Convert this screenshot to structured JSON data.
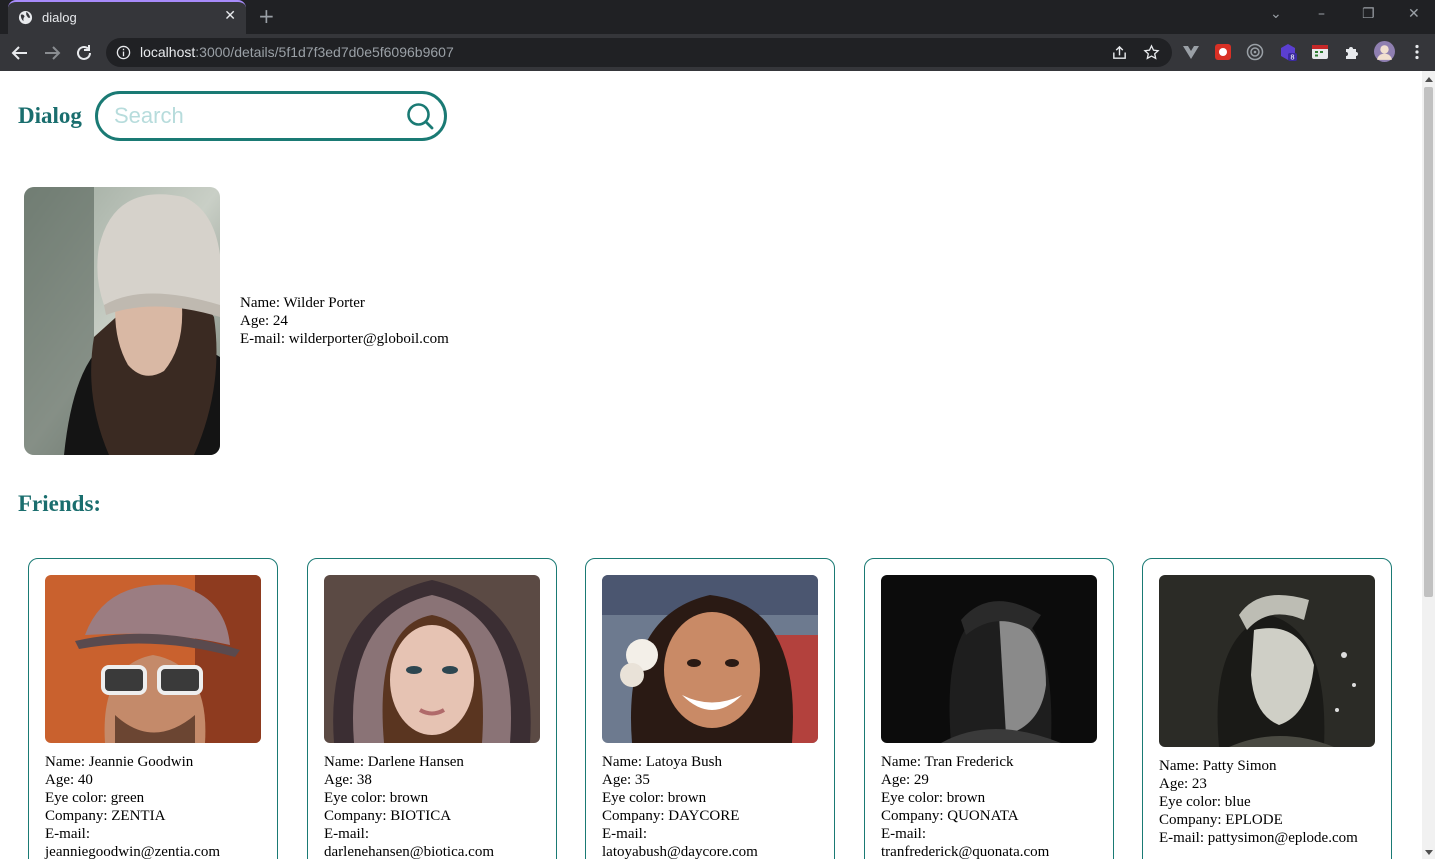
{
  "browser": {
    "tab_title": "dialog",
    "url_host": "localhost",
    "url_rest": ":3000/details/5f1d7f3ed7d0e5f6096b9607",
    "extension_badge": "8"
  },
  "app": {
    "brand": "Dialog",
    "search_placeholder": "Search"
  },
  "profile": {
    "name": "Name: Wilder Porter",
    "age": "Age: 24",
    "email": "E-mail: wilderporter@globoil.com"
  },
  "friends_title": "Friends:",
  "friends": [
    {
      "name": "Name: Jeannie Goodwin",
      "age": "Age: 40",
      "eye": "Eye color: green",
      "company": "Company: ZENTIA",
      "email_label": "E-mail:",
      "email": "jeanniegoodwin@zentia.com"
    },
    {
      "name": "Name: Darlene Hansen",
      "age": "Age: 38",
      "eye": "Eye color: brown",
      "company": "Company: BIOTICA",
      "email_label": "E-mail:",
      "email": "darlenehansen@biotica.com"
    },
    {
      "name": "Name: Latoya Bush",
      "age": "Age: 35",
      "eye": "Eye color: brown",
      "company": "Company: DAYCORE",
      "email_label": "E-mail:",
      "email": "latoyabush@daycore.com"
    },
    {
      "name": "Name: Tran Frederick",
      "age": "Age: 29",
      "eye": "Eye color: brown",
      "company": "Company: QUONATA",
      "email_label": "E-mail:",
      "email": "tranfrederick@quonata.com"
    },
    {
      "name": "Name: Patty Simon",
      "age": "Age: 23",
      "eye": "Eye color: blue",
      "company": "Company: EPLODE",
      "email_full": "E-mail: pattysimon@eplode.com"
    }
  ],
  "colors": {
    "accent": "#1a7a74",
    "chrome_dark": "#202124",
    "chrome_mid": "#35363a"
  }
}
